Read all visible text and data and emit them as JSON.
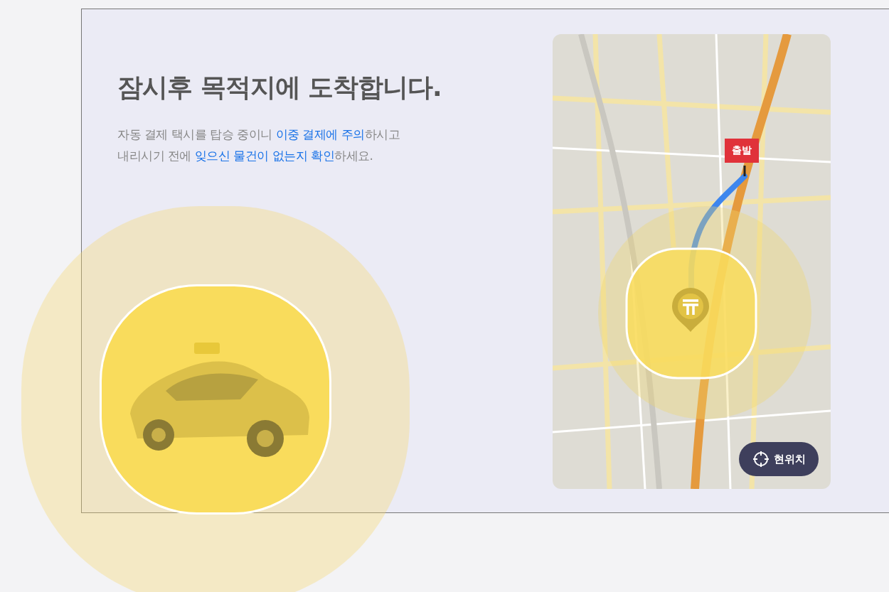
{
  "heading": "잠시후 목적지에 도착합니다.",
  "description_lines": [
    "자동 결제 택시를 탑승 중이니 **이중 결제에 주의**하시고",
    "내리시기 전에 **잊으신 물건이 없는지 확인**하세요."
  ],
  "map": {
    "origin_label": "출발",
    "location_button": "현위치"
  }
}
